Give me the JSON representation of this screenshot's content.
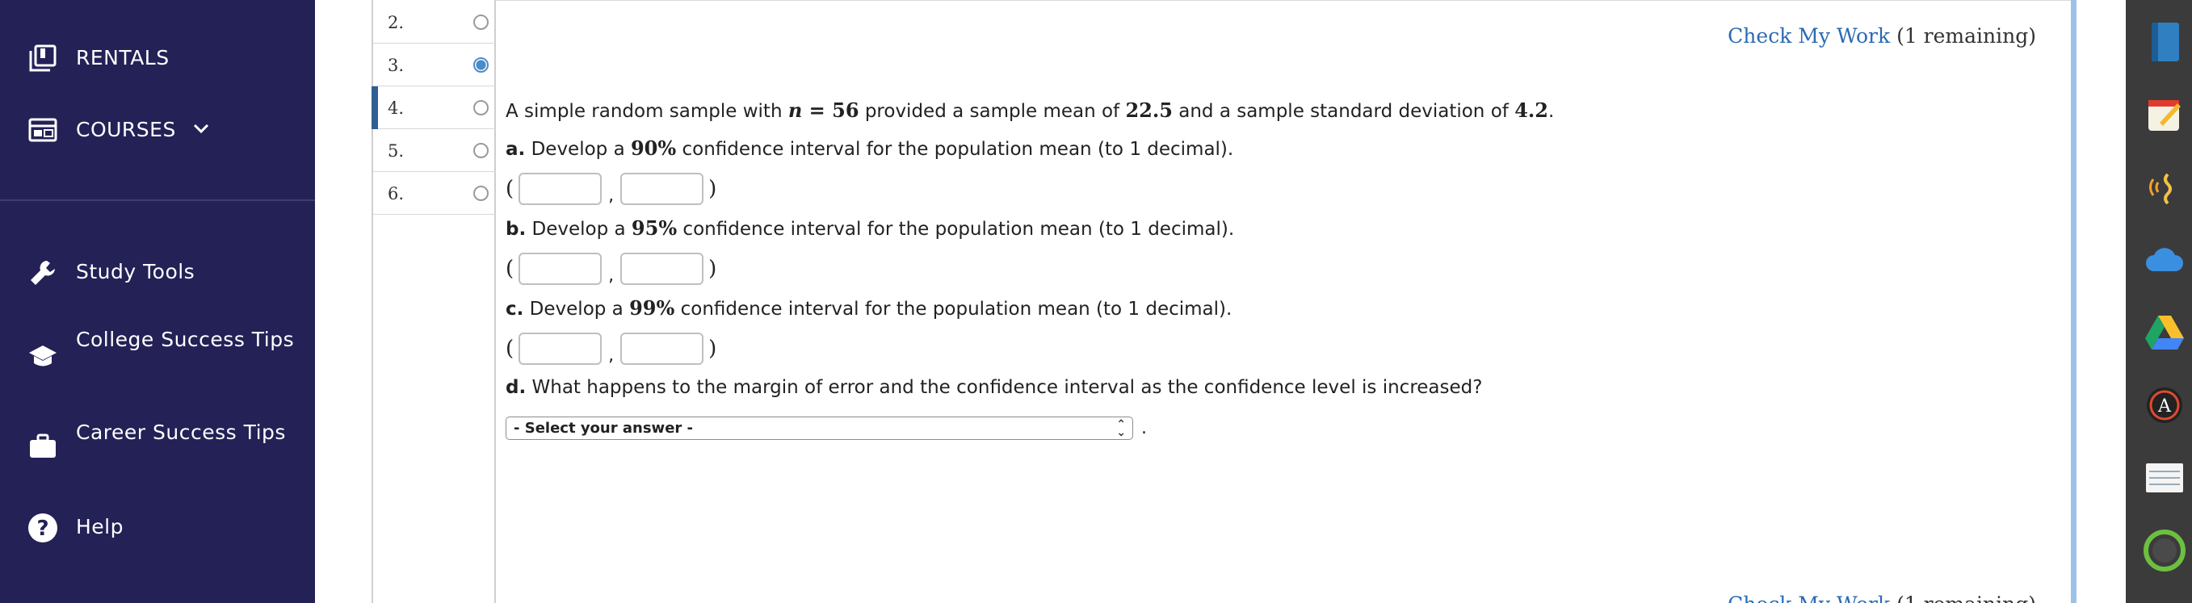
{
  "sidebar": {
    "items": [
      {
        "label": "RENTALS",
        "icon": "rentals-icon"
      },
      {
        "label": "COURSES",
        "icon": "courses-icon"
      },
      {
        "label": "Study Tools",
        "icon": "wrench-icon"
      },
      {
        "label": "College Success Tips",
        "icon": "graduation-cap-icon"
      },
      {
        "label": "Career Success Tips",
        "icon": "briefcase-icon"
      },
      {
        "label": "Help",
        "icon": "help-icon"
      }
    ]
  },
  "questions": [
    {
      "number": "2.",
      "answered": false
    },
    {
      "number": "3.",
      "answered": true
    },
    {
      "number": "4.",
      "answered": false,
      "active": true
    },
    {
      "number": "5.",
      "answered": false
    },
    {
      "number": "6.",
      "answered": false
    }
  ],
  "check_work": {
    "link": "Check My Work",
    "remaining": "(1 remaining)"
  },
  "problem": {
    "intro_a": "A simple random sample with ",
    "n_var": "n",
    "n_eq": " = 56",
    "intro_b": " provided a sample mean of ",
    "mean": "22.5",
    "intro_c": " and a sample standard deviation of ",
    "sd": "4.2",
    "intro_end": ".",
    "parts": [
      {
        "letter": "a.",
        "pre": " Develop a ",
        "level": "90%",
        "post": " confidence interval for the population mean (to 1 decimal)."
      },
      {
        "letter": "b.",
        "pre": " Develop a ",
        "level": "95%",
        "post": " confidence interval for the population mean (to 1 decimal)."
      },
      {
        "letter": "c.",
        "pre": " Develop a ",
        "level": "99%",
        "post": " confidence interval for the population mean (to 1 decimal)."
      }
    ],
    "part_d": {
      "letter": "d.",
      "text": " What happens to the margin of error and the confidence interval as the confidence level is increased?"
    },
    "select_value": "- Select your answer -",
    "open_paren": "(",
    "close_paren": ")",
    "comma": ",",
    "period": "."
  },
  "colors": {
    "sidebar_bg": "#232156",
    "link": "#2a6ab3",
    "active_marker": "#2f5e93",
    "answered_radio": "#4a8cc9"
  }
}
